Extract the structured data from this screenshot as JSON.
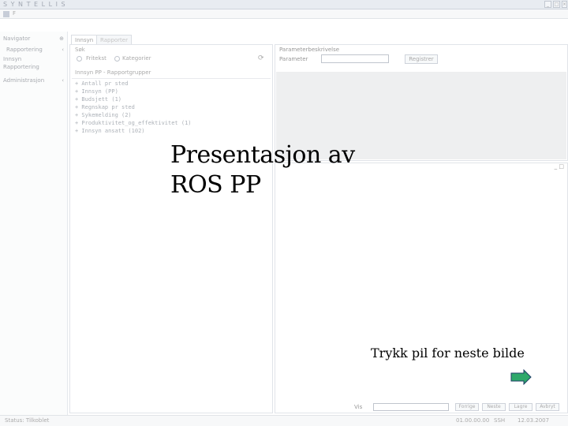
{
  "app": {
    "title": "S Y N T E L L I S",
    "window_controls": [
      "_",
      "□",
      "×"
    ],
    "menu": [
      "F"
    ]
  },
  "sidebar": {
    "header": "Navigator",
    "items": [
      {
        "label": "Rapportering",
        "pin": "‹"
      },
      {
        "label": "Innsyn"
      },
      {
        "label": "Rapportering"
      },
      {
        "label": "Administrasjon",
        "pin": "‹"
      }
    ]
  },
  "tabs": [
    {
      "label": "Innsyn"
    },
    {
      "label": "Rapporter"
    }
  ],
  "search": {
    "title": "Søk",
    "option_fritekst": "Fritekst",
    "option_kategori": "Kategorier",
    "tree_header": "Innsyn PP - Rapportgrupper",
    "tree_items": [
      "+ Antall pr sted",
      "+ Innsyn (PP)",
      "+ Budsjett (1)",
      "+ Regnskap pr sted",
      "+ Sykemelding (2)",
      "+ Produktivitet_og_effektivitet (1)",
      "+ Innsyn ansatt (102)"
    ]
  },
  "right_panel": {
    "title": "Parameterbeskrivelse",
    "field_label": "Parameter",
    "field_value": "",
    "button_label": "Registrer"
  },
  "bottom_controls": {
    "label": "Vis",
    "buttons": [
      "Forrige",
      "Neste",
      "Lagre",
      "Avbryt"
    ]
  },
  "statusbar": {
    "left": "Status: Tilkoblet",
    "version": "01.00.00.00",
    "user": "SSH",
    "date": "12.03.2007"
  },
  "slide": {
    "title_line1": "Presentasjon av",
    "title_line2": "ROS PP",
    "hint": "Trykk pil for neste bilde",
    "arrow_color": "#2ea86a"
  }
}
